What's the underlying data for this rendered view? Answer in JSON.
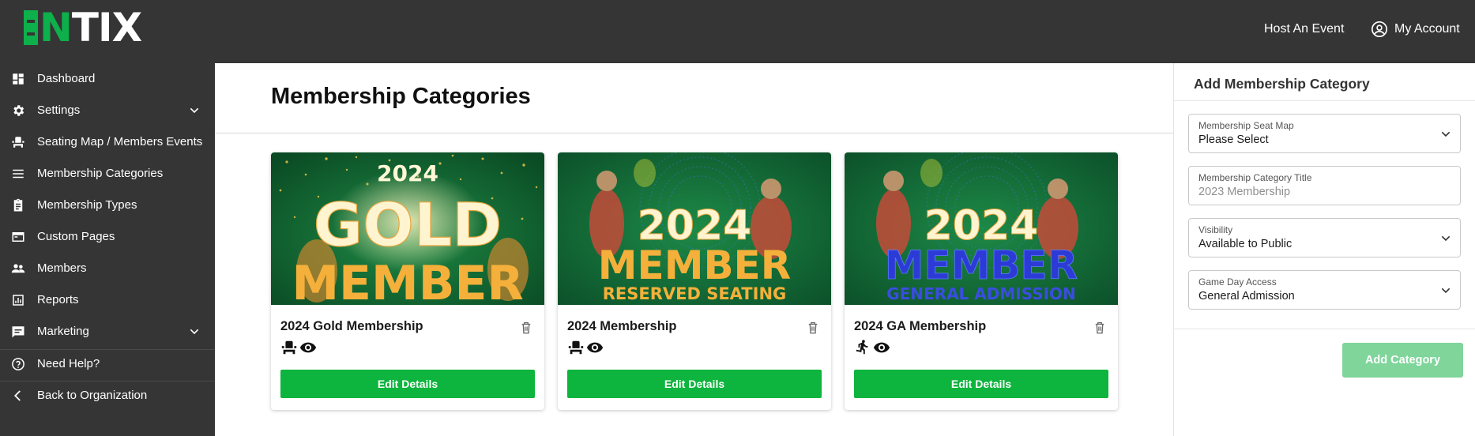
{
  "brand": {
    "logo_letter_n": "N",
    "logo_letters_tix": "TIX",
    "accent_color": "#0db04b"
  },
  "topbar": {
    "host_event": "Host An Event",
    "my_account": "My Account"
  },
  "sidebar": {
    "items": [
      {
        "label": "Dashboard",
        "icon": "dashboard-icon"
      },
      {
        "label": "Settings",
        "icon": "gear-icon",
        "expandable": true
      },
      {
        "label": "Seating Map / Members Events",
        "icon": "seat-icon"
      },
      {
        "label": "Membership Categories",
        "icon": "list-icon"
      },
      {
        "label": "Membership Types",
        "icon": "clipboard-icon"
      },
      {
        "label": "Custom Pages",
        "icon": "page-icon"
      },
      {
        "label": "Members",
        "icon": "people-icon"
      },
      {
        "label": "Reports",
        "icon": "report-icon"
      },
      {
        "label": "Marketing",
        "icon": "chat-icon",
        "expandable": true
      },
      {
        "label": "Need Help?",
        "icon": "help-icon"
      },
      {
        "label": "Back to Organization",
        "icon": "back-chevron-icon"
      }
    ]
  },
  "main": {
    "title": "Membership Categories",
    "cards": [
      {
        "title": "2024 Gold Membership",
        "image_year": "2024",
        "image_line1": "GOLD",
        "image_line2": "MEMBER",
        "image_line3": "",
        "icons": [
          "seat-icon",
          "eye-icon"
        ],
        "button": "Edit Details"
      },
      {
        "title": "2024 Membership",
        "image_year": "2024",
        "image_line1": "MEMBER",
        "image_line2": "RESERVED SEATING",
        "image_line3": "",
        "icons": [
          "seat-icon",
          "eye-icon"
        ],
        "button": "Edit Details"
      },
      {
        "title": "2024 GA Membership",
        "image_year": "2024",
        "image_line1": "MEMBER",
        "image_line2": "GENERAL ADMISSION",
        "image_line3": "",
        "icons": [
          "walking-person-icon",
          "eye-icon"
        ],
        "button": "Edit Details"
      }
    ]
  },
  "panel": {
    "title": "Add Membership Category",
    "seat_map": {
      "label": "Membership Seat Map",
      "value": "Please Select"
    },
    "category_title": {
      "label": "Membership Category Title",
      "placeholder": "2023 Membership"
    },
    "visibility": {
      "label": "Visibility",
      "value": "Available to Public"
    },
    "game_day": {
      "label": "Game Day Access",
      "value": "General Admission"
    },
    "submit": "Add Category"
  }
}
